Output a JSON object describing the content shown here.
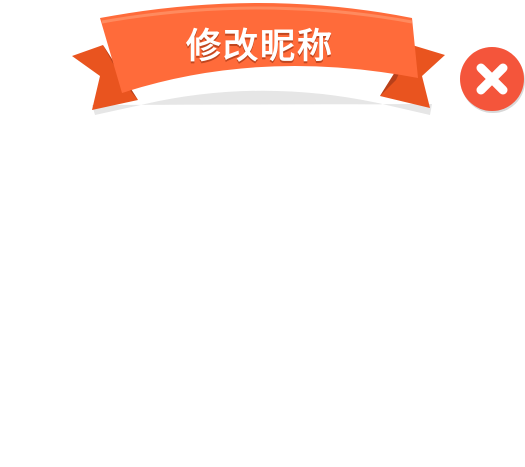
{
  "dialog": {
    "title": "修改昵称"
  },
  "close_button": {
    "icon": "close-icon"
  },
  "colors": {
    "ribbon_main": "#FF6B3A",
    "ribbon_dark": "#E2511E",
    "ribbon_shadow": "#E5E5E5",
    "close_red": "#F4553B",
    "background": "#FFFFFF"
  }
}
